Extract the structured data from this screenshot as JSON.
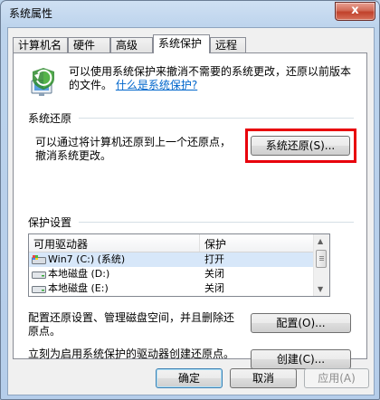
{
  "window": {
    "title": "系统属性",
    "close_glyph": "x"
  },
  "tabs": [
    {
      "label": "计算机名"
    },
    {
      "label": "硬件"
    },
    {
      "label": "高级"
    },
    {
      "label": "系统保护"
    },
    {
      "label": "远程"
    }
  ],
  "intro": {
    "text": "可以使用系统保护来撤消不需要的系统更改，还原以前版本的文件。",
    "link": "什么是系统保护?"
  },
  "restore": {
    "title": "系统还原",
    "desc_line1": "可以通过将计算机还原到上一个还原点，",
    "desc_line2": "撤消系统更改。",
    "button": "系统还原(S)..."
  },
  "protection": {
    "title": "保护设置",
    "columns": [
      "可用驱动器",
      "保护"
    ],
    "drives": [
      {
        "name": "Win7 (C:) (系统)",
        "protection": "打开"
      },
      {
        "name": "本地磁盘 (D:)",
        "protection": "关闭"
      },
      {
        "name": "本地磁盘 (E:)",
        "protection": "关闭"
      }
    ],
    "config_line1": "配置还原设置、管理磁盘空间，并且删除还",
    "config_line2": "原点。",
    "config_button": "配置(O)...",
    "create_text": "立刻为启用系统保护的驱动器创建还原点。",
    "create_button": "创建(C)..."
  },
  "footer": {
    "ok": "确定",
    "cancel": "取消",
    "apply": "应用(A)"
  },
  "colors": {
    "highlight": "#e8000b",
    "link": "#0066cc",
    "selection": "#d7e7f9"
  }
}
